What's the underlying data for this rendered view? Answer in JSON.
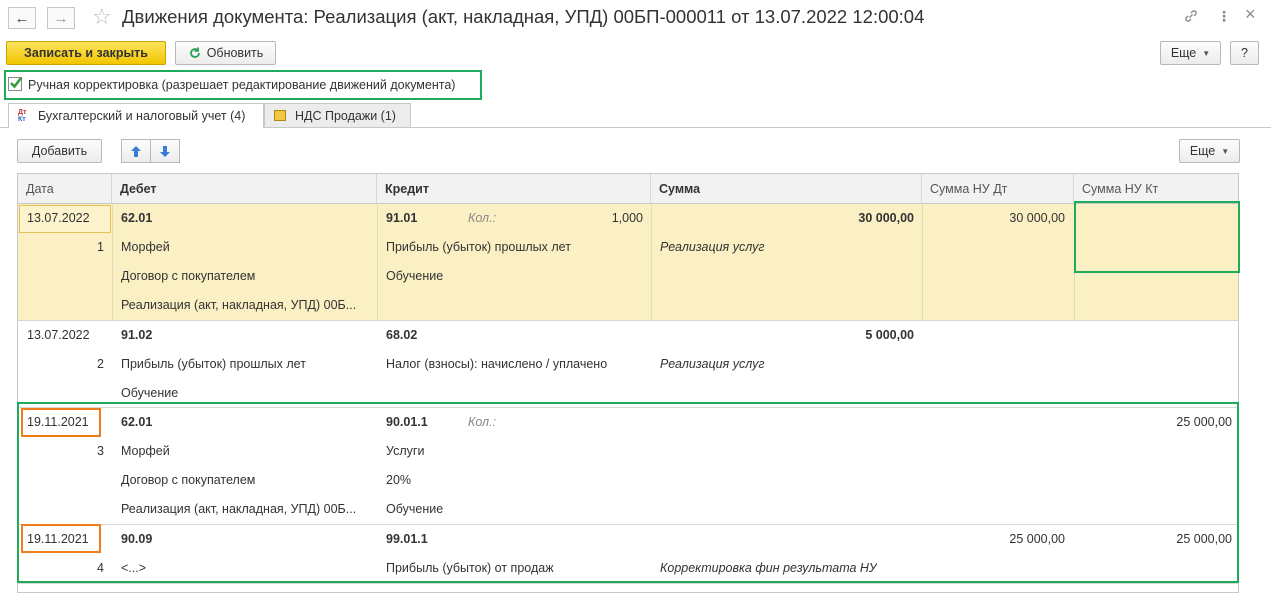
{
  "window": {
    "title": "Движения документа: Реализация (акт, накладная, УПД) 00БП-000011 от 13.07.2022 12:00:04",
    "back_icon": "←",
    "forward_icon": "→",
    "star_icon": "☆",
    "link_icon": "🔗",
    "more_icon": "⋮",
    "close_icon": "×"
  },
  "toolbar": {
    "save_close_label": "Записать и закрыть",
    "refresh_label": "Обновить",
    "more_label": "Еще",
    "help_label": "?"
  },
  "manual_edit": {
    "checked": true,
    "label": "Ручная корректировка (разрешает редактирование движений документа)"
  },
  "tabs": [
    {
      "label": "Бухгалтерский и налоговый учет (4)",
      "icon_text": "ДтКт",
      "active": true
    },
    {
      "label": "НДС Продажи (1)",
      "icon_text": "",
      "active": false
    }
  ],
  "table_toolbar": {
    "add_label": "Добавить",
    "up_icon": "▲",
    "down_icon": "▼",
    "more_label": "Еще"
  },
  "columns": {
    "date": "Дата",
    "debit": "Дебет",
    "credit": "Кредит",
    "sum": "Сумма",
    "sum_nu_dt": "Сумма НУ Дт",
    "sum_nu_kt": "Сумма НУ Кт"
  },
  "rows": [
    {
      "date": "13.07.2022",
      "num": "1",
      "debit_acc": "62.01",
      "debit_sub": [
        "Морфей",
        "Договор с покупателем",
        "Реализация (акт, накладная, УПД) 00Б..."
      ],
      "credit_acc": "91.01",
      "qty_label": "Кол.:",
      "qty": "1,000",
      "credit_sub": [
        "Прибыль (убыток) прошлых лет",
        "Обучение"
      ],
      "sum": "30 000,00",
      "content": "Реализация услуг",
      "sum_nu_dt": "30 000,00",
      "sum_nu_kt": ""
    },
    {
      "date": "13.07.2022",
      "num": "2",
      "debit_acc": "91.02",
      "debit_sub": [
        "Прибыль (убыток) прошлых лет",
        "Обучение"
      ],
      "credit_acc": "68.02",
      "qty_label": "",
      "qty": "",
      "credit_sub": [
        "Налог (взносы): начислено / уплачено"
      ],
      "sum": "5 000,00",
      "content": "Реализация услуг",
      "sum_nu_dt": "",
      "sum_nu_kt": ""
    },
    {
      "date": "19.11.2021",
      "num": "3",
      "debit_acc": "62.01",
      "debit_sub": [
        "Морфей",
        "Договор с покупателем",
        "Реализация (акт, накладная, УПД) 00Б..."
      ],
      "credit_acc": "90.01.1",
      "qty_label": "Кол.:",
      "qty": "",
      "credit_sub": [
        "Услуги",
        "20%",
        "Обучение"
      ],
      "sum": "",
      "content": "",
      "sum_nu_dt": "",
      "sum_nu_kt": "25 000,00"
    },
    {
      "date": "19.11.2021",
      "num": "4",
      "debit_acc": "90.09",
      "debit_sub": [
        "<...>"
      ],
      "credit_acc": "99.01.1",
      "qty_label": "",
      "qty": "",
      "credit_sub": [
        "Прибыль (убыток) от продаж"
      ],
      "sum": "",
      "content": "Корректировка фин результата НУ",
      "sum_nu_dt": "25 000,00",
      "sum_nu_kt": "25 000,00"
    }
  ],
  "colors": {
    "selected_row": "#fbf0c3",
    "highlight_green": "#1eab5b",
    "highlight_orange": "#f07d1a",
    "primary_button": "#f2c600"
  }
}
